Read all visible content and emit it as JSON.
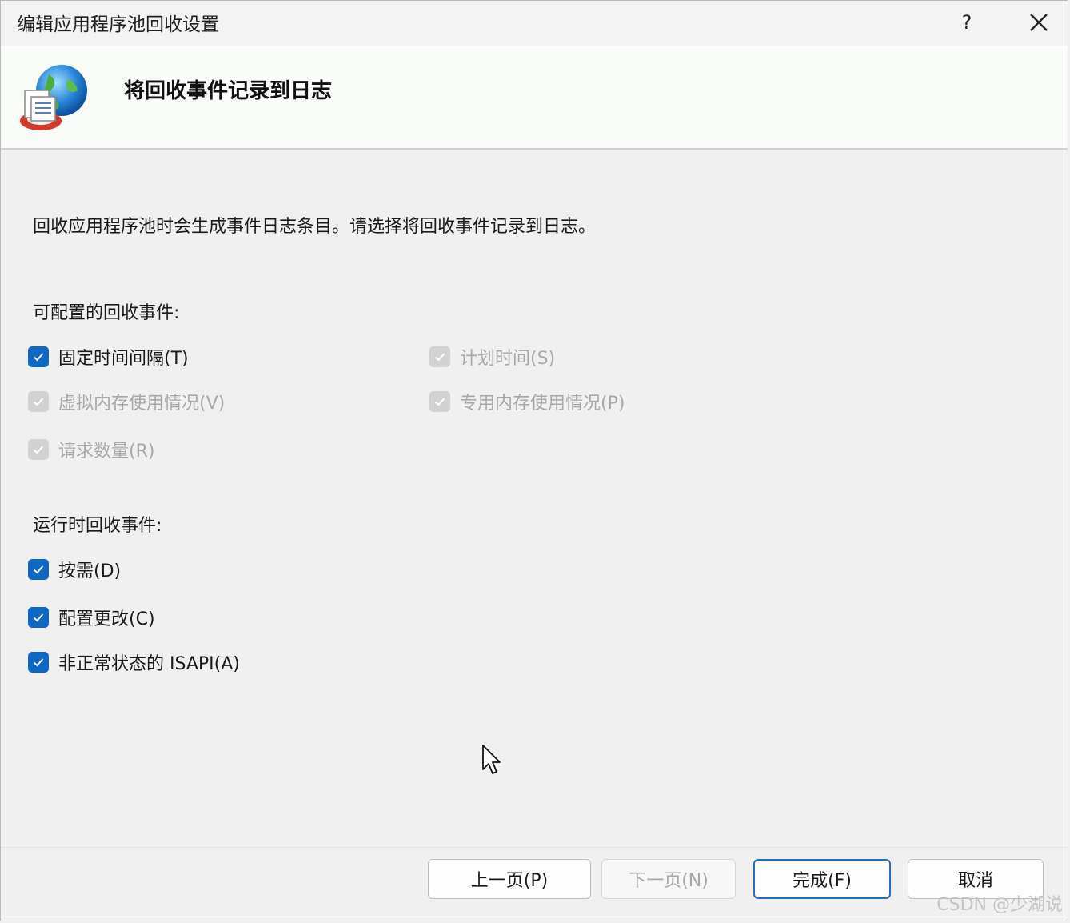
{
  "window": {
    "title": "编辑应用程序池回收设置",
    "help_label": "?",
    "page_heading": "将回收事件记录到日志"
  },
  "description": "回收应用程序池时会生成事件日志条目。请选择将回收事件记录到日志。",
  "configurable": {
    "label": "可配置的回收事件:",
    "items": [
      {
        "label": "固定时间间隔(T)",
        "checked": true,
        "enabled": true
      },
      {
        "label": "计划时间(S)",
        "checked": true,
        "enabled": false
      },
      {
        "label": "虚拟内存使用情况(V)",
        "checked": true,
        "enabled": false
      },
      {
        "label": "专用内存使用情况(P)",
        "checked": true,
        "enabled": false
      },
      {
        "label": "请求数量(R)",
        "checked": true,
        "enabled": false
      }
    ]
  },
  "runtime": {
    "label": "运行时回收事件:",
    "items": [
      {
        "label": "按需(D)",
        "checked": true,
        "enabled": true
      },
      {
        "label": "配置更改(C)",
        "checked": true,
        "enabled": true
      },
      {
        "label": "非正常状态的 ISAPI(A)",
        "checked": true,
        "enabled": true
      }
    ]
  },
  "buttons": {
    "prev": "上一页(P)",
    "next": "下一页(N)",
    "finish": "完成(F)",
    "cancel": "取消"
  },
  "watermark": "CSDN @少湖说",
  "colors": {
    "accent": "#0f68c4",
    "disabled": "#d2d2d2"
  }
}
